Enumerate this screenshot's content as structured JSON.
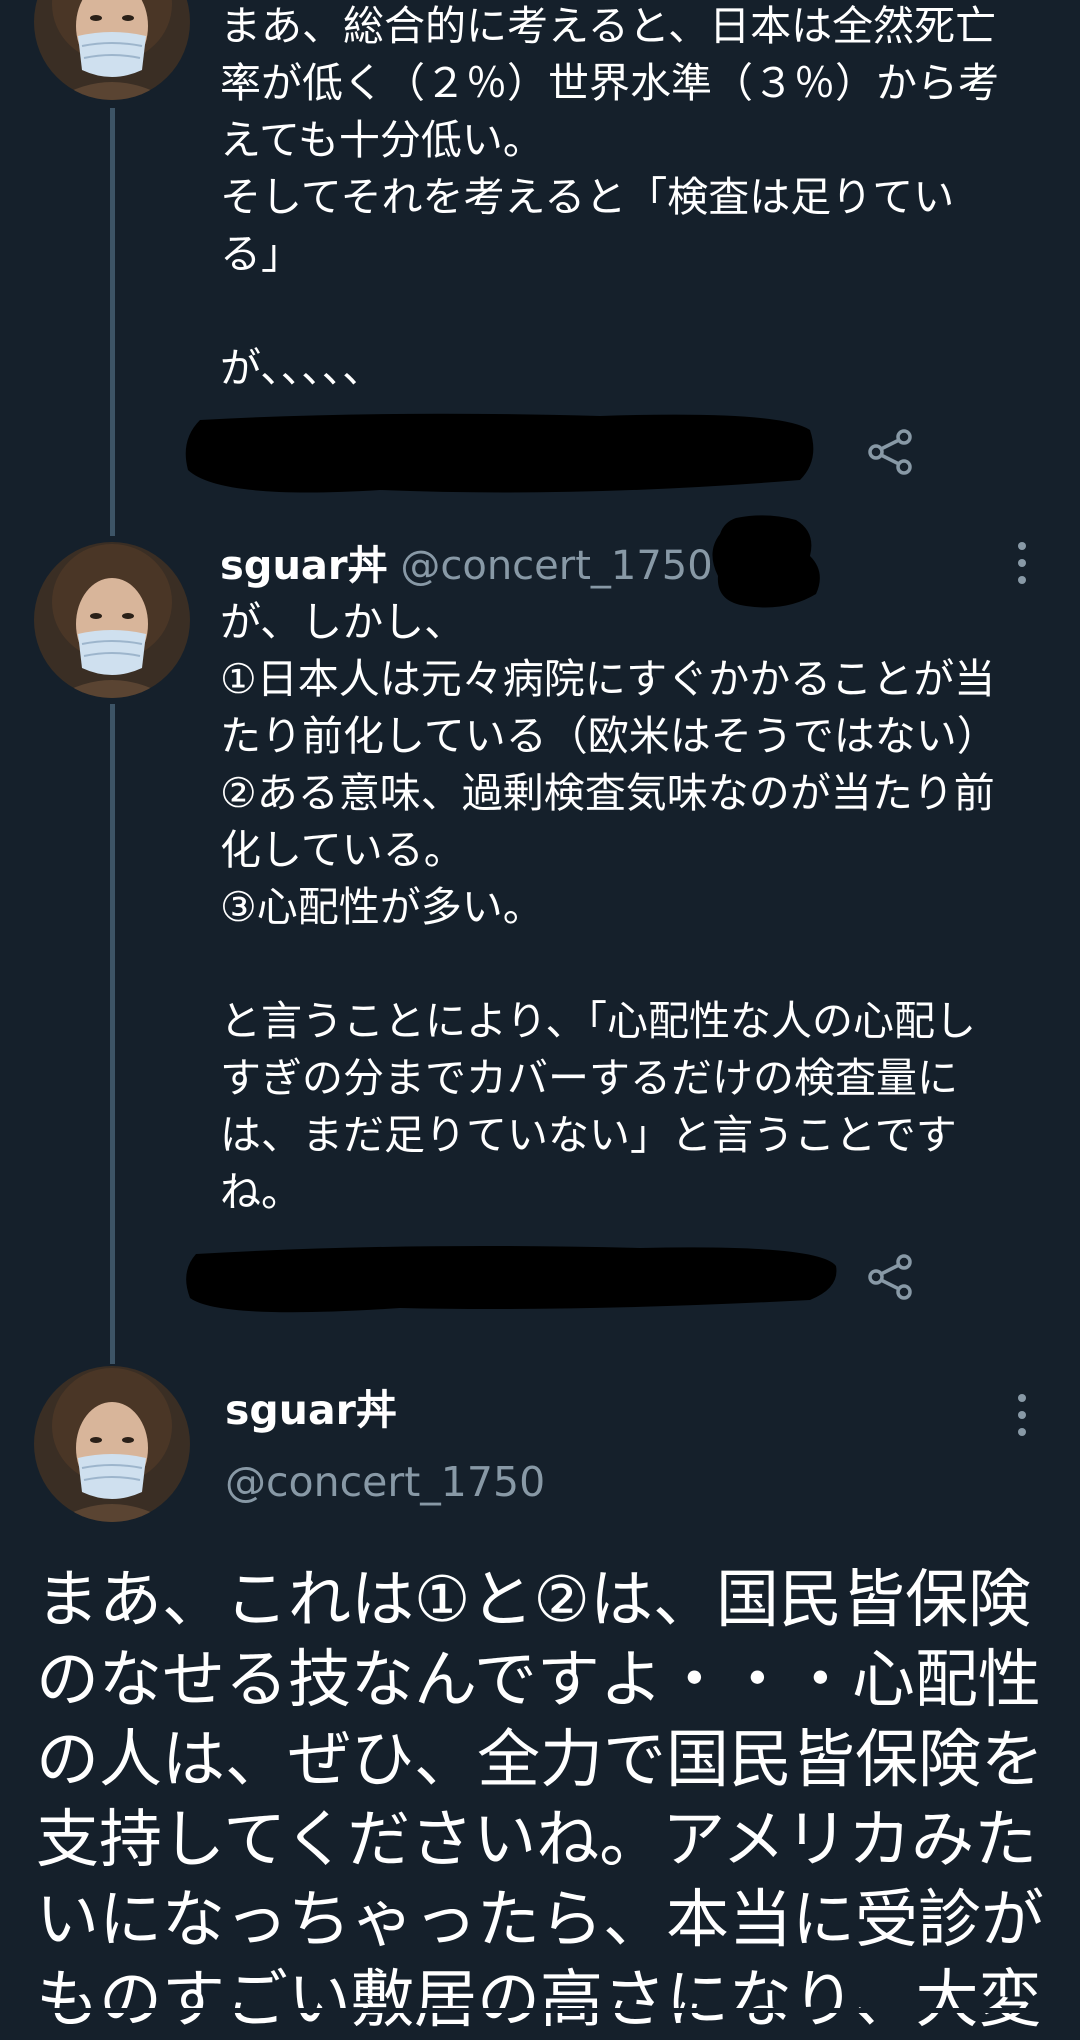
{
  "tweets": [
    {
      "name": "",
      "handle": "",
      "text": "まあ、総合的に考えると、日本は全然死亡\n率が低く（２％）世界水準（３％）から考\nえても十分低い。\nそしてそれを考えると「検査は足りてい\nる」\n\nが、、、、、"
    },
    {
      "name": "sguar丼",
      "handle": "@concert_1750",
      "separator": "·",
      "text": "が、しかし、\n①日本人は元々病院にすぐかかることが当\nたり前化している（欧米はそうではない）\n②ある意味、過剰検査気味なのが当たり前\n化している。\n③心配性が多い。\n\nと言うことにより、「心配性な人の心配し\nすぎの分までカバーするだけの検査量に\nは、まだ足りていない」と言うことです\nね。"
    }
  ],
  "main_tweet": {
    "name": "sguar丼",
    "handle": "@concert_1750",
    "text": "まあ、これは①と②は、国民皆保険\nのなせる技なんですよ・・・心配性\nの人は、ぜひ、全力で国民皆保険を\n支持してくださいね。アメリカみた\nいになっちゃったら、本当に受診が\nものすごい敷居の高さになり、大変"
  },
  "icons": {
    "avatar": "avatar-image",
    "share": "share-icon",
    "more": "more-options-icon"
  },
  "colors": {
    "background": "#15202b",
    "text": "#ffffff",
    "secondary_text": "#8899a6",
    "thread_line": "#3d5466",
    "icon": "#8899a6"
  }
}
